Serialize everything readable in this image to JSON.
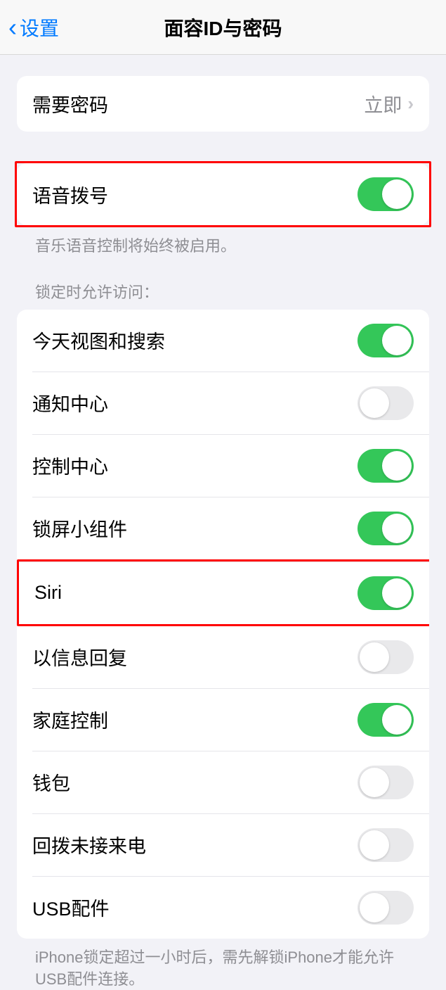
{
  "header": {
    "back_label": "设置",
    "title": "面容ID与密码"
  },
  "require_passcode": {
    "label": "需要密码",
    "value": "立即"
  },
  "voice_dial": {
    "label": "语音拨号",
    "enabled": true,
    "footer": "音乐语音控制将始终被启用。"
  },
  "lock_access": {
    "header": "锁定时允许访问：",
    "items": [
      {
        "label": "今天视图和搜索",
        "enabled": true
      },
      {
        "label": "通知中心",
        "enabled": false
      },
      {
        "label": "控制中心",
        "enabled": true
      },
      {
        "label": "锁屏小组件",
        "enabled": true
      },
      {
        "label": "Siri",
        "enabled": true
      },
      {
        "label": "以信息回复",
        "enabled": false
      },
      {
        "label": "家庭控制",
        "enabled": true
      },
      {
        "label": "钱包",
        "enabled": false
      },
      {
        "label": "回拨未接来电",
        "enabled": false
      },
      {
        "label": "USB配件",
        "enabled": false
      }
    ],
    "footer": "iPhone锁定超过一小时后，需先解锁iPhone才能允许USB配件连接。"
  }
}
